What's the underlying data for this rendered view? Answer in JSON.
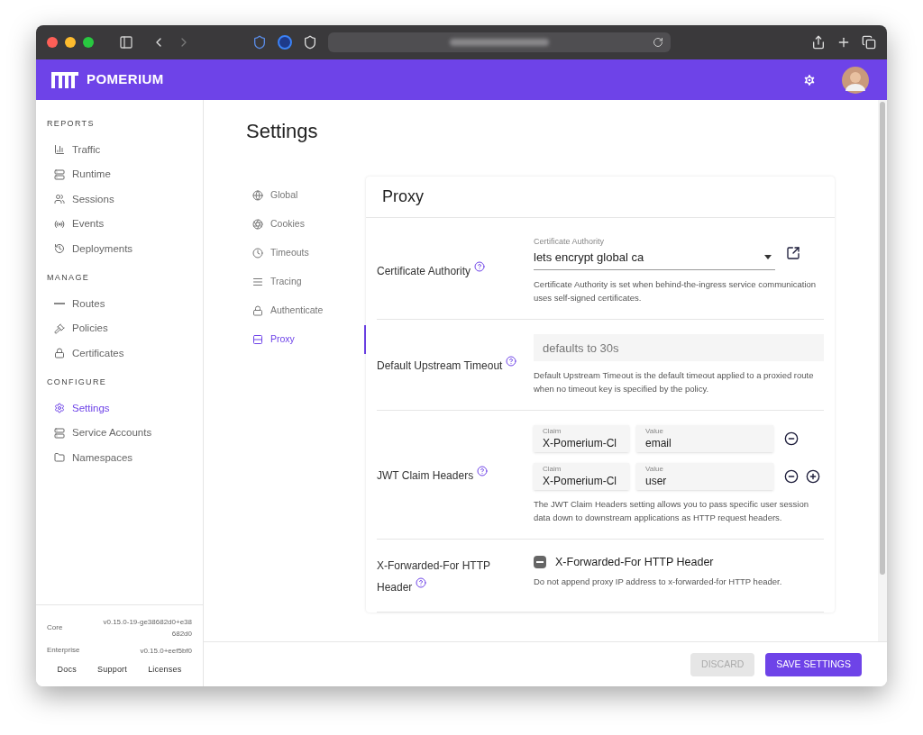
{
  "header": {
    "logo": "POMERIUM"
  },
  "sidebar": {
    "sections": [
      {
        "title": "REPORTS",
        "items": [
          {
            "label": "Traffic",
            "selected": false
          },
          {
            "label": "Runtime",
            "selected": false
          },
          {
            "label": "Sessions",
            "selected": false
          },
          {
            "label": "Events",
            "selected": false
          },
          {
            "label": "Deployments",
            "selected": false
          }
        ]
      },
      {
        "title": "MANAGE",
        "items": [
          {
            "label": "Routes",
            "selected": false
          },
          {
            "label": "Policies",
            "selected": false
          },
          {
            "label": "Certificates",
            "selected": false
          }
        ]
      },
      {
        "title": "CONFIGURE",
        "items": [
          {
            "label": "Settings",
            "selected": true
          },
          {
            "label": "Service Accounts",
            "selected": false
          },
          {
            "label": "Namespaces",
            "selected": false
          }
        ]
      }
    ],
    "versions": [
      {
        "label": "Core",
        "value": "v0.15.0-19-ge38682d0+e38682d0"
      },
      {
        "label": "Enterprise",
        "value": "v0.15.0+eef5bf0"
      }
    ],
    "links": [
      "Docs",
      "Support",
      "Licenses"
    ]
  },
  "page": {
    "title": "Settings",
    "nav": [
      {
        "label": "Global",
        "selected": false
      },
      {
        "label": "Cookies",
        "selected": false
      },
      {
        "label": "Timeouts",
        "selected": false
      },
      {
        "label": "Tracing",
        "selected": false
      },
      {
        "label": "Authenticate",
        "selected": false
      },
      {
        "label": "Proxy",
        "selected": true
      }
    ],
    "card": {
      "title": "Proxy",
      "rows": [
        {
          "kind": "select",
          "label": "Certificate Authority",
          "field_label": "Certificate Authority",
          "value": "lets encrypt global ca",
          "help": "Certificate Authority is set when behind-the-ingress service communication uses self-signed certificates."
        },
        {
          "kind": "text",
          "label": "Default Upstream Timeout",
          "placeholder": "defaults to 30s",
          "help": "Default Upstream Timeout is the default timeout applied to a proxied route when no timeout key is specified by the policy."
        },
        {
          "kind": "claims",
          "label": "JWT Claim Headers",
          "claims": [
            {
              "claim_label": "Claim",
              "claim": "X-Pomerium-Cl",
              "value_label": "Value",
              "value": "email"
            },
            {
              "claim_label": "Claim",
              "claim": "X-Pomerium-Cl",
              "value_label": "Value",
              "value": "user"
            }
          ],
          "help": "The JWT Claim Headers setting allows you to pass specific user session data down to downstream applications as HTTP request headers."
        },
        {
          "kind": "checkbox",
          "label": "X-Forwarded-For HTTP Header",
          "checkbox_label": "X-Forwarded-For HTTP Header",
          "indeterminate": true,
          "help": "Do not append proxy IP address to x-forwarded-for HTTP header."
        }
      ]
    }
  },
  "footer": {
    "buttons": [
      {
        "kind": "secondary",
        "label": "DISCARD",
        "disabled": true
      },
      {
        "kind": "primary",
        "label": "SAVE SETTINGS",
        "disabled": false
      }
    ]
  }
}
